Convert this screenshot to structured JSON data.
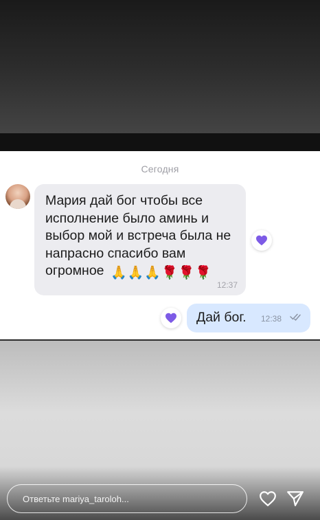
{
  "chat": {
    "date_label": "Сегодня",
    "incoming": {
      "text": "Мария дай бог чтобы все исполнение было аминь и выбор мой и встреча была не напрасно спасибо вам огромное",
      "emojis": [
        "🙏",
        "🙏",
        "🙏",
        "🌹",
        "🌹",
        "🌹"
      ],
      "time": "12:37",
      "reaction_icon": "heart-icon"
    },
    "outgoing": {
      "text": "Дай бог.",
      "time": "12:38",
      "status_icon": "double-check-icon",
      "reaction_icon": "heart-icon"
    }
  },
  "reply": {
    "placeholder": "Ответьте mariya_taroloh..."
  },
  "actions": {
    "like_icon": "heart-icon",
    "send_icon": "paper-plane-icon"
  },
  "colors": {
    "incoming_bubble": "#ececf0",
    "outgoing_bubble": "#d8e8ff",
    "reaction_heart": "#7d5be6"
  }
}
